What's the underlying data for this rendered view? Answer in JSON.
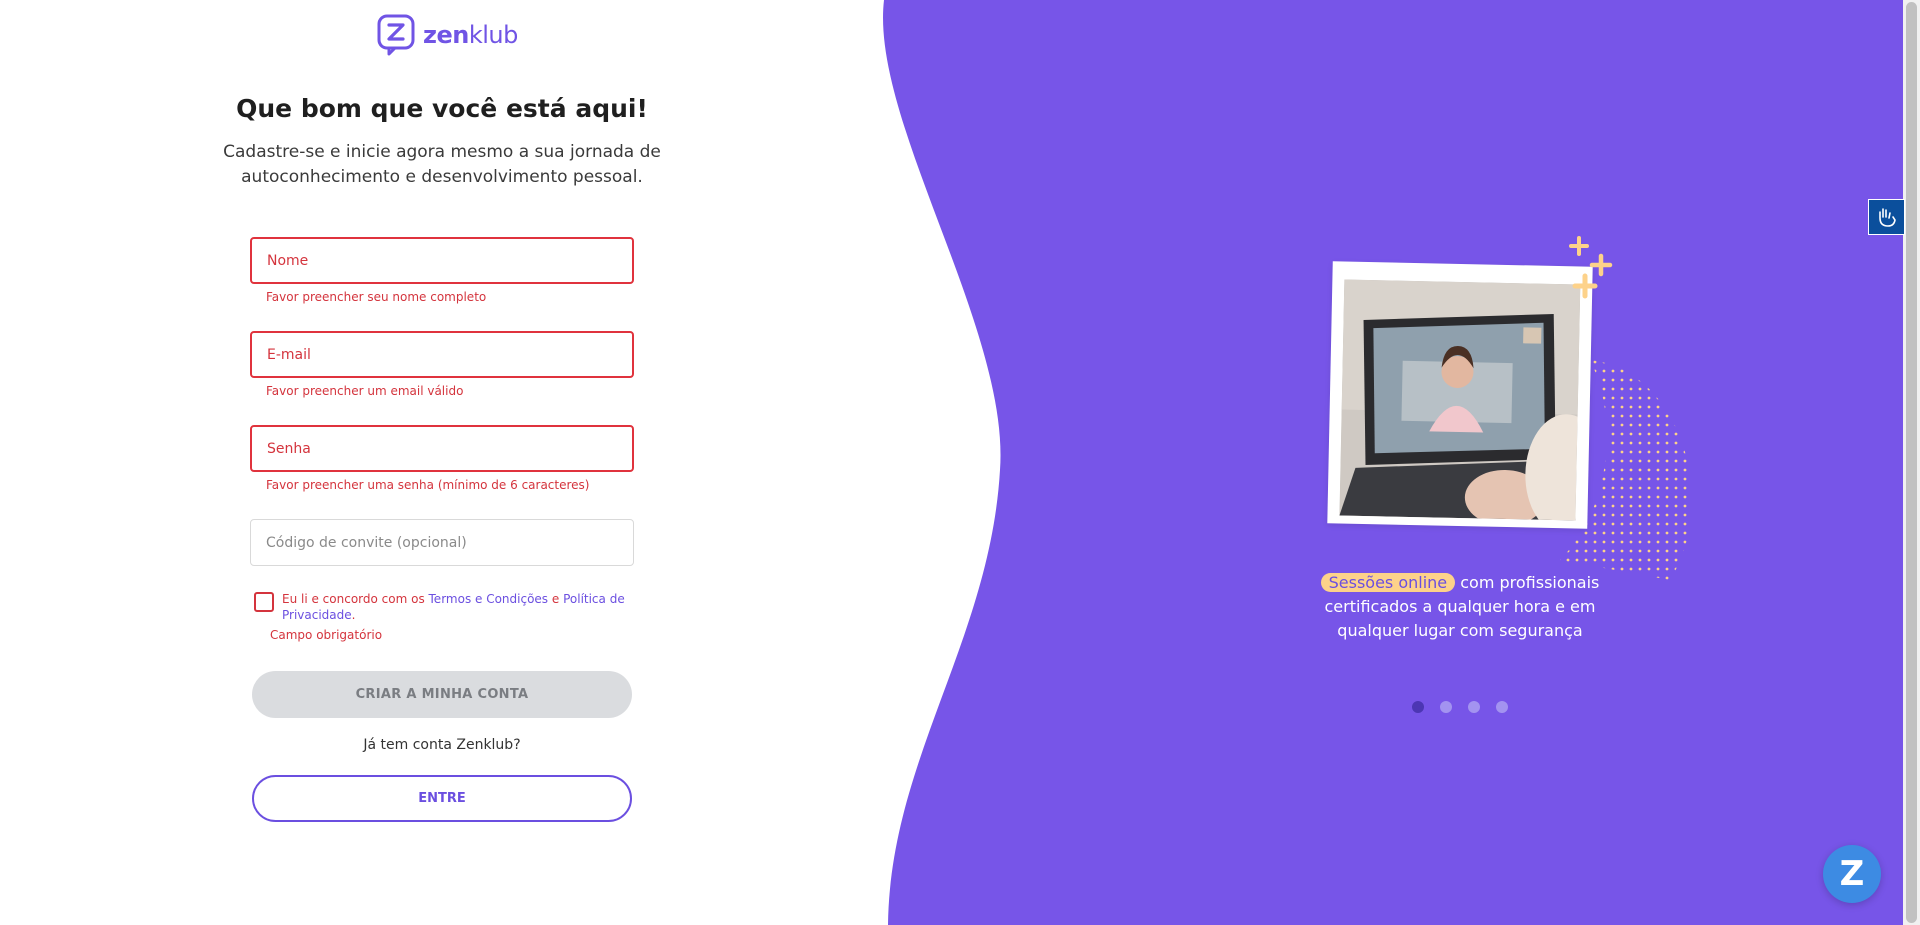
{
  "brand": {
    "name_prefix": "zen",
    "name_suffix": "klub"
  },
  "header": {
    "title": "Que bom que você está aqui!",
    "subtitle": "Cadastre-se e inicie agora mesmo a sua jornada de autoconhecimento e desenvolvimento pessoal."
  },
  "form": {
    "name_placeholder": "Nome",
    "name_error": "Favor preencher seu nome completo",
    "email_placeholder": "E-mail",
    "email_error": "Favor preencher um email válido",
    "password_placeholder": "Senha",
    "password_error": "Favor preencher uma senha (mínimo de 6 caracteres)",
    "invite_placeholder": "Código de convite (opcional)",
    "terms_prefix": "Eu li e concordo com os ",
    "terms_link": "Termos e Condições",
    "terms_and": " e ",
    "privacy_link": "Política de Privacidade",
    "terms_suffix": ".",
    "required_error": "Campo obrigatório",
    "create_button": "CRIAR A MINHA CONTA",
    "have_account": "Já tem conta Zenklub?",
    "enter_button": "ENTRE"
  },
  "carousel": {
    "highlight": "Sessões online",
    "caption_rest": " com profissionais certificados a qualquer hora e em qualquer lugar com segurança",
    "slides": 4,
    "active_slide": 1
  },
  "chat": {
    "label": "Z"
  },
  "colors": {
    "brand": "#7054e5",
    "panel": "#7755e8",
    "error": "#d4343d",
    "accent_highlight": "#fdd28a"
  }
}
